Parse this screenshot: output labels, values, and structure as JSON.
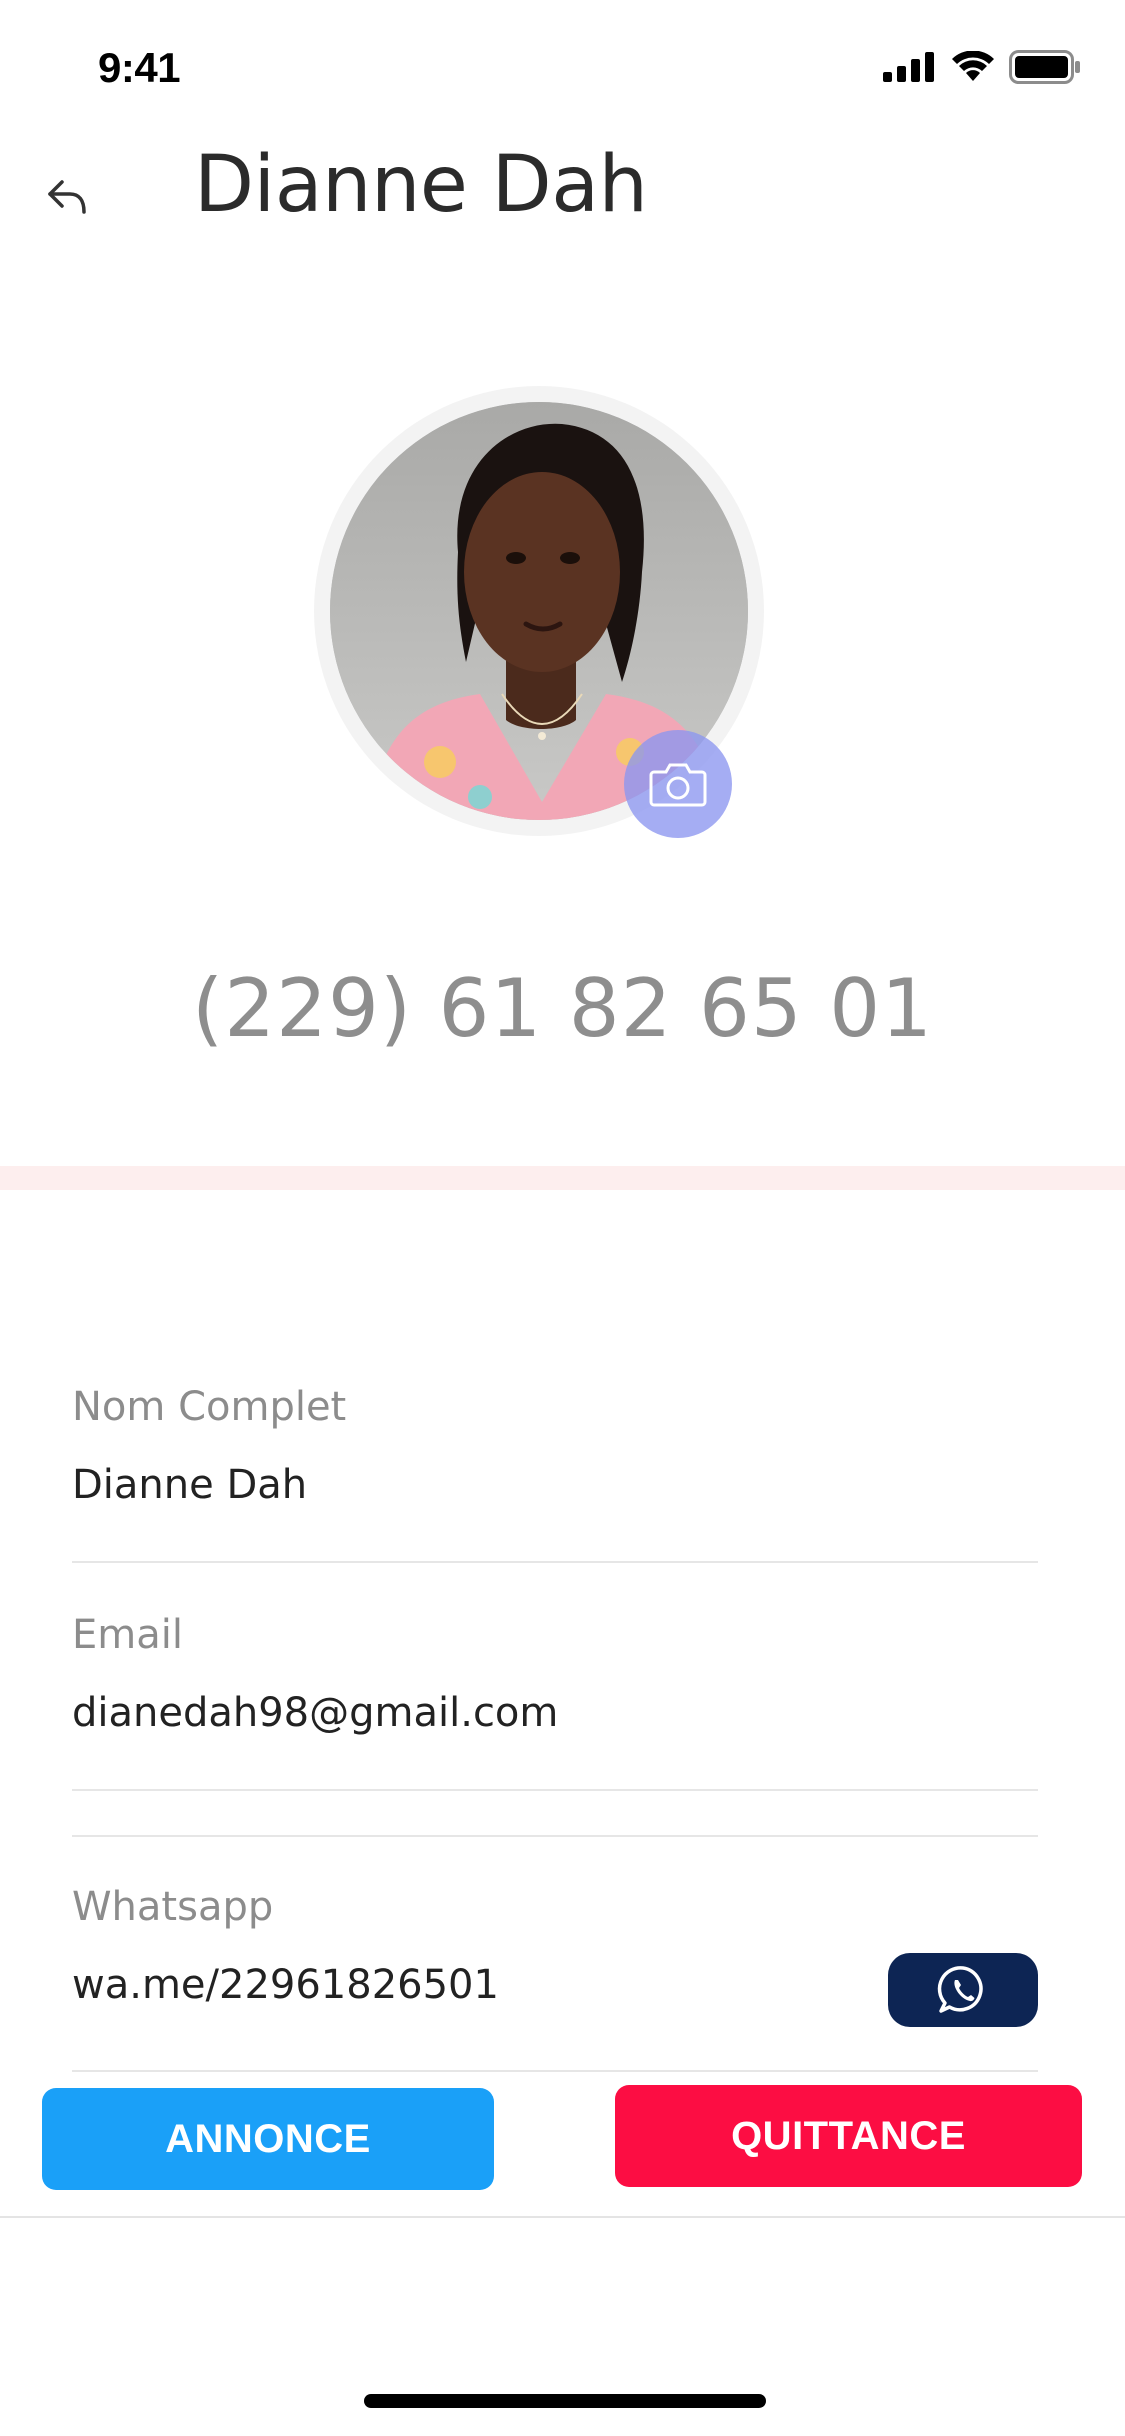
{
  "status_bar": {
    "time": "9:41"
  },
  "nav": {
    "title": "Dianne Dah"
  },
  "profile": {
    "phone_display": "(229) 61 82 65 01"
  },
  "fields": [
    {
      "label": "Nom Complet",
      "value": "Dianne Dah"
    },
    {
      "label": "Email",
      "value": "dianedah98@gmail.com"
    },
    {
      "label": "Whatsapp",
      "value": "wa.me/22961826501"
    }
  ],
  "actions": {
    "annonce_label": "ANNONCE",
    "quittance_label": "QUITTANCE"
  },
  "colors": {
    "annonce": "#1aa0f8",
    "quittance": "#fc0d43",
    "whatsapp_button": "#0d2554",
    "camera_badge": "#8c96f0",
    "divider_band": "#fdeeee"
  },
  "icons": {
    "back": "back-arrow-icon",
    "camera": "camera-icon",
    "whatsapp": "whatsapp-icon",
    "signal": "signal-icon",
    "wifi": "wifi-icon",
    "battery": "battery-icon"
  }
}
